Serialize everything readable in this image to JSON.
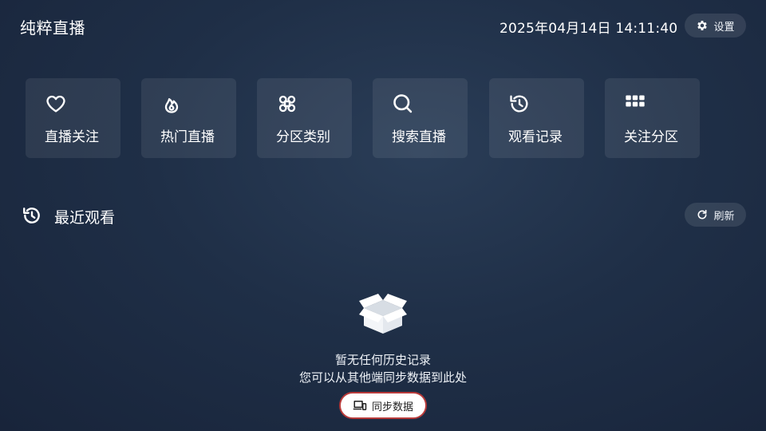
{
  "header": {
    "app_title": "纯粹直播",
    "datetime": "2025年04月14日 14:11:40",
    "settings_label": "设置",
    "settings_icon": "gear-icon"
  },
  "tiles": [
    {
      "label": "直播关注",
      "icon": "heart-icon"
    },
    {
      "label": "热门直播",
      "icon": "flame-icon"
    },
    {
      "label": "分区类别",
      "icon": "command-icon"
    },
    {
      "label": "搜索直播",
      "icon": "search-icon"
    },
    {
      "label": "观看记录",
      "icon": "history-icon"
    },
    {
      "label": "关注分区",
      "icon": "grid-icon"
    }
  ],
  "recent": {
    "title": "最近观看",
    "icon": "history-icon",
    "refresh_label": "刷新",
    "empty_line1": "暂无任何历史记录",
    "empty_line2": "您可以从其他端同步数据到此处",
    "sync_label": "同步数据"
  },
  "colors": {
    "background": "#1f2f47",
    "focus_border": "#b83a3a"
  }
}
